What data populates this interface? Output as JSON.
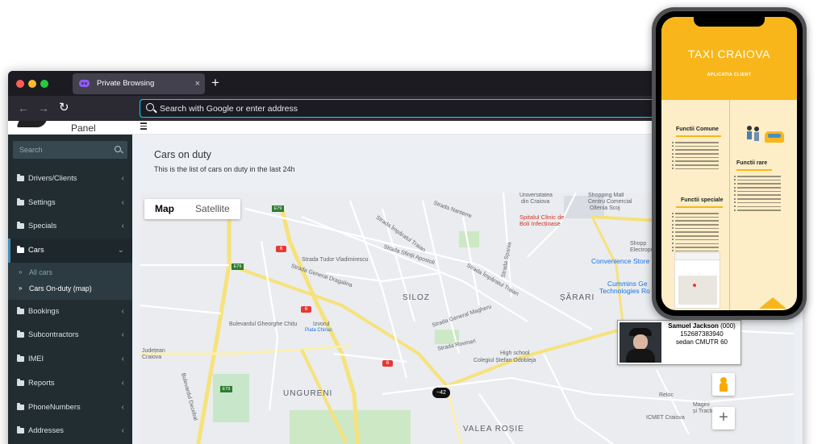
{
  "browser": {
    "tab_title": "Private Browsing",
    "new_tab": "+",
    "close_tab": "×",
    "back": "←",
    "forward": "→",
    "reload": "↻",
    "url_placeholder": "Search with Google or enter address"
  },
  "admin": {
    "panel_label": "Panel",
    "search_placeholder": "Search",
    "menu": [
      {
        "label": "Drivers/Clients",
        "chev": "‹"
      },
      {
        "label": "Settings",
        "chev": "‹"
      },
      {
        "label": "Specials",
        "chev": "‹"
      },
      {
        "label": "Cars",
        "chev": "⌄"
      },
      {
        "label": "Bookings",
        "chev": "‹"
      },
      {
        "label": "Subcontractors",
        "chev": "‹"
      },
      {
        "label": "IMEI",
        "chev": "‹"
      },
      {
        "label": "Reports",
        "chev": "‹"
      },
      {
        "label": "PhoneNumbers",
        "chev": "‹"
      },
      {
        "label": "Addresses",
        "chev": "‹"
      }
    ],
    "submenu": [
      {
        "label": "All cars",
        "bullet": "»"
      },
      {
        "label": "Cars On-duty (map)",
        "bullet": "»"
      }
    ],
    "page_title": "Cars on duty",
    "page_subtitle": "This is the list of cars on duty in the last 24h"
  },
  "map": {
    "type_map": "Map",
    "type_satellite": "Satellite",
    "zoom_in": "+",
    "car_marker": "~42",
    "labels": {
      "siloz": "SILOZ",
      "sarari": "ȘĂRARI",
      "ungureni": "UNGURENI",
      "valea_rosie": "VALEA ROȘIE",
      "universitatea": "Universitatea",
      "din_craiova": "din Craiova",
      "spitalul": "Spitalul Clinic de",
      "boli": "Boli Infecțioase",
      "shopping": "Shopping Mall",
      "centru_comercial": "Centru Comercial",
      "oltenia": "Oltenia Scoj",
      "convenience": "Convenience Store",
      "cummins": "Cummins Ge",
      "technologies": "Technologies Ro",
      "shopp": "Shopp",
      "electropu": "Electropu",
      "high_school": "High school",
      "colegiul": "Colegiul Ștefan Odobleja",
      "reloc": "Reloc",
      "magini": "Magini",
      "si_tracto": "și Tracto",
      "icmet": "ICMET Craiova",
      "judetean": "Județean",
      "craiova": "Craiova",
      "izvorul": "Izvorul",
      "piata": "Piata Chiriac",
      "str_nanterre": "Strada Nanterre",
      "str_imparatul": "Strada Împăratul Traian",
      "str_sfintii": "Strada Sfinții Apostoli",
      "str_dragalina": "Strada General Dragalina",
      "str_magheru": "Strada General Magheru",
      "str_traian": "Strada Împăratul Traian",
      "str_rovinari": "Strada Rovinari",
      "bd_ghica": "Bulevardul Gheorghe Chițu",
      "bd_decebal": "Bulevardul Decebal",
      "str_spania": "Strada Spania",
      "str_tudor": "Strada Tudor Vladimirescu",
      "e79": "E79",
      "r6": "6"
    }
  },
  "driver": {
    "name": "Samuel Jackson",
    "code": "(000)",
    "phone": "152687383940",
    "car": "sedan CMUTR 60"
  },
  "phone": {
    "title": "TAXI CRAIOVA",
    "subtitle": "APLICATIA CLIENT",
    "sections": {
      "comune": "Functii Comune",
      "rare": "Functii rare",
      "speciale": "Functii speciale"
    }
  },
  "colors": {
    "sidebar": "#222d32",
    "accent": "#3c8dbc",
    "taxi_yellow": "#f9b61a"
  }
}
